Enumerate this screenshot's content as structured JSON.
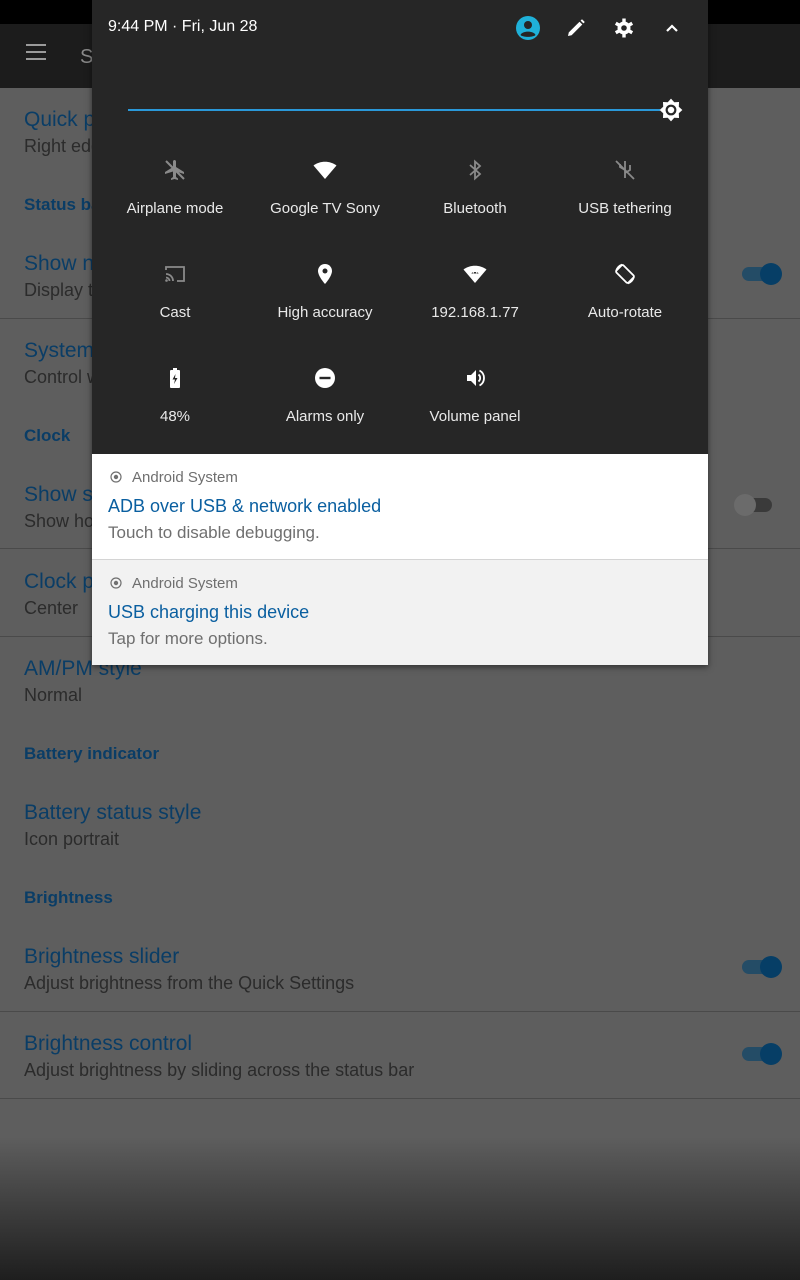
{
  "settings": {
    "quick_pulldown": {
      "title": "Quick p",
      "summary": "Right edg"
    },
    "cat_status_bar": "Status ba",
    "show_notif": {
      "title": "Show n",
      "summary": "Display t"
    },
    "system_icons": {
      "title": "System",
      "summary": "Control w"
    },
    "cat_clock": "Clock",
    "show_seconds": {
      "title": "Show s",
      "summary": "Show ho"
    },
    "clock_position": {
      "title": "Clock p",
      "summary": "Center"
    },
    "ampm": {
      "title": "AM/PM style",
      "summary": "Normal"
    },
    "cat_battery": "Battery indicator",
    "battery_style": {
      "title": "Battery status style",
      "summary": "Icon portrait"
    },
    "cat_brightness": "Brightness",
    "brightness_slider": {
      "title": "Brightness slider",
      "summary": "Adjust brightness from the Quick Settings"
    },
    "brightness_control": {
      "title": "Brightness control",
      "summary": "Adjust brightness by sliding across the status bar"
    },
    "app_title": "S"
  },
  "quick_settings": {
    "datetime": "9:44 PM · Fri, Jun 28",
    "header_icons": [
      "account-icon",
      "edit-icon",
      "settings-icon",
      "collapse-icon"
    ],
    "brightness_level": 1.0,
    "accent_color": "#2a98d8",
    "tiles": [
      {
        "label": "Airplane mode",
        "icon": "airplane-icon"
      },
      {
        "label": "Google TV Sony",
        "icon": "wifi-icon"
      },
      {
        "label": "Bluetooth",
        "icon": "bluetooth-icon"
      },
      {
        "label": "USB tethering",
        "icon": "usb-tethering-icon"
      },
      {
        "label": "Cast",
        "icon": "cast-icon"
      },
      {
        "label": "High accuracy",
        "icon": "location-icon"
      },
      {
        "label": "192.168.1.77",
        "icon": "adb-network-icon"
      },
      {
        "label": "Auto-rotate",
        "icon": "rotate-icon"
      },
      {
        "label": "48%",
        "icon": "battery-icon"
      },
      {
        "label": "Alarms only",
        "icon": "do-not-disturb-icon"
      },
      {
        "label": "Volume panel",
        "icon": "volume-icon"
      }
    ]
  },
  "notifications": [
    {
      "app": "Android System",
      "title": "ADB over USB & network enabled",
      "text": "Touch to disable debugging."
    },
    {
      "app": "Android System",
      "title": "USB charging this device",
      "text": "Tap for more options."
    }
  ]
}
